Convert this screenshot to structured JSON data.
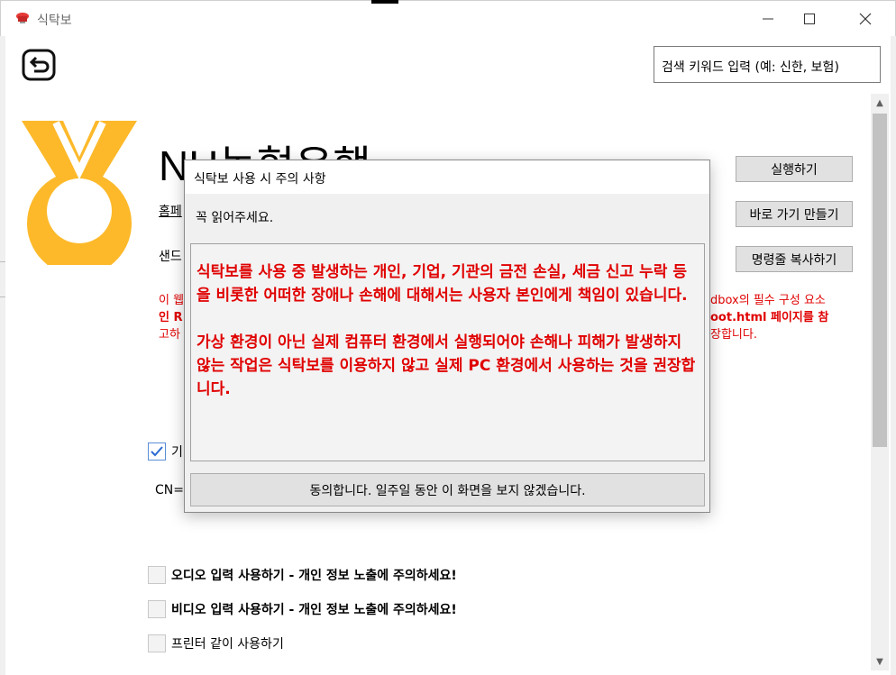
{
  "window": {
    "title": "식탁보"
  },
  "search": {
    "placeholder": "검색 키워드 입력 (예: 신한, 보험)"
  },
  "main": {
    "bank_name": "NH농협은행",
    "homepage_label": "홈페",
    "sandbox_label": "샌드",
    "notice_lines": [
      {
        "left": "이 웹",
        "right": "dbox의 필수 구성 요소"
      },
      {
        "left": "인 R",
        "right": "oot.html 페이지를 참"
      },
      {
        "left": "고하",
        "right": "장합니다."
      }
    ],
    "first_checkbox_label": "기",
    "cn_label": "CN="
  },
  "buttons": {
    "run": "실행하기",
    "shortcut": "바로 가기 만들기",
    "copy_cmd": "명령줄 복사하기"
  },
  "options": [
    {
      "label": "오디오 입력 사용하기 - 개인 정보 노출에 주의하세요!",
      "checked": false
    },
    {
      "label": "비디오 입력 사용하기 - 개인 정보 노출에 주의하세요!",
      "checked": false
    },
    {
      "label": "프린터 같이 사용하기",
      "checked": false
    }
  ],
  "modal": {
    "title": "식탁보 사용 시 주의 사항",
    "subtitle": "꼭 읽어주세요.",
    "paragraph1": "식탁보를 사용 중 발생하는 개인, 기업, 기관의 금전 손실, 세금 신고 누락 등을 비롯한 어떠한 장애나 손해에 대해서는 사용자 본인에게 책임이 있습니다.",
    "paragraph2": "가상 환경이 아닌 실제 컴퓨터 환경에서 실행되어야 손해나 피해가 발생하지 않는 작업은 식탁보를 이용하지 않고 실제 PC 환경에서 사용하는 것을 권장합니다.",
    "agree_label": "동의합니다. 일주일 동안 이 화면을 보지 않겠습니다."
  },
  "colors": {
    "logo": "#FDB92A",
    "warning": "#E00000"
  }
}
